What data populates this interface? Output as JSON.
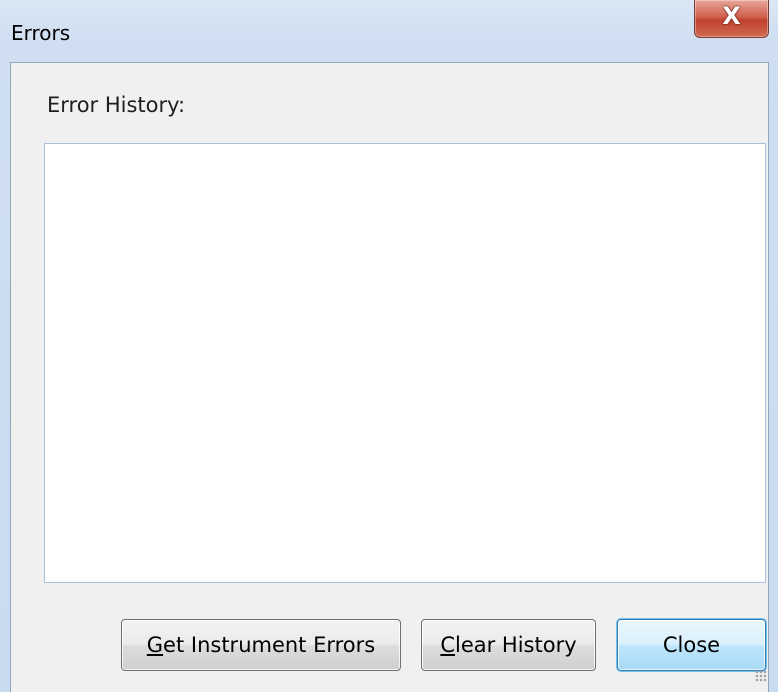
{
  "window": {
    "title": "Errors",
    "close_glyph": "X"
  },
  "history": {
    "label": "Error History:",
    "content": ""
  },
  "buttons": {
    "get_errors": {
      "mnemonic": "G",
      "rest": "et Instrument Errors"
    },
    "clear_history": {
      "mnemonic": "C",
      "rest": "lear History"
    },
    "close": {
      "label": "Close"
    }
  },
  "colors": {
    "client_bg": "#f0f0f0",
    "close_button_accent": "#c0432f",
    "default_button_border": "#3c7fb1"
  }
}
